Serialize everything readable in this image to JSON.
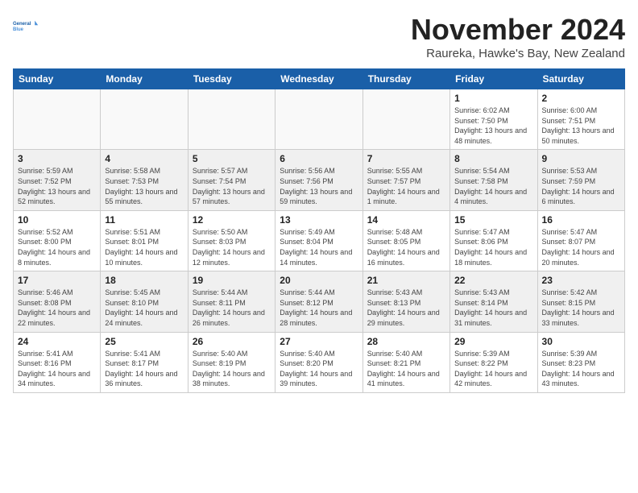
{
  "logo": {
    "line1": "General",
    "line2": "Blue"
  },
  "title": "November 2024",
  "location": "Raureka, Hawke's Bay, New Zealand",
  "days_of_week": [
    "Sunday",
    "Monday",
    "Tuesday",
    "Wednesday",
    "Thursday",
    "Friday",
    "Saturday"
  ],
  "weeks": [
    {
      "days": [
        {
          "num": "",
          "info": ""
        },
        {
          "num": "",
          "info": ""
        },
        {
          "num": "",
          "info": ""
        },
        {
          "num": "",
          "info": ""
        },
        {
          "num": "",
          "info": ""
        },
        {
          "num": "1",
          "info": "Sunrise: 6:02 AM\nSunset: 7:50 PM\nDaylight: 13 hours and 48 minutes."
        },
        {
          "num": "2",
          "info": "Sunrise: 6:00 AM\nSunset: 7:51 PM\nDaylight: 13 hours and 50 minutes."
        }
      ]
    },
    {
      "days": [
        {
          "num": "3",
          "info": "Sunrise: 5:59 AM\nSunset: 7:52 PM\nDaylight: 13 hours and 52 minutes."
        },
        {
          "num": "4",
          "info": "Sunrise: 5:58 AM\nSunset: 7:53 PM\nDaylight: 13 hours and 55 minutes."
        },
        {
          "num": "5",
          "info": "Sunrise: 5:57 AM\nSunset: 7:54 PM\nDaylight: 13 hours and 57 minutes."
        },
        {
          "num": "6",
          "info": "Sunrise: 5:56 AM\nSunset: 7:56 PM\nDaylight: 13 hours and 59 minutes."
        },
        {
          "num": "7",
          "info": "Sunrise: 5:55 AM\nSunset: 7:57 PM\nDaylight: 14 hours and 1 minute."
        },
        {
          "num": "8",
          "info": "Sunrise: 5:54 AM\nSunset: 7:58 PM\nDaylight: 14 hours and 4 minutes."
        },
        {
          "num": "9",
          "info": "Sunrise: 5:53 AM\nSunset: 7:59 PM\nDaylight: 14 hours and 6 minutes."
        }
      ]
    },
    {
      "days": [
        {
          "num": "10",
          "info": "Sunrise: 5:52 AM\nSunset: 8:00 PM\nDaylight: 14 hours and 8 minutes."
        },
        {
          "num": "11",
          "info": "Sunrise: 5:51 AM\nSunset: 8:01 PM\nDaylight: 14 hours and 10 minutes."
        },
        {
          "num": "12",
          "info": "Sunrise: 5:50 AM\nSunset: 8:03 PM\nDaylight: 14 hours and 12 minutes."
        },
        {
          "num": "13",
          "info": "Sunrise: 5:49 AM\nSunset: 8:04 PM\nDaylight: 14 hours and 14 minutes."
        },
        {
          "num": "14",
          "info": "Sunrise: 5:48 AM\nSunset: 8:05 PM\nDaylight: 14 hours and 16 minutes."
        },
        {
          "num": "15",
          "info": "Sunrise: 5:47 AM\nSunset: 8:06 PM\nDaylight: 14 hours and 18 minutes."
        },
        {
          "num": "16",
          "info": "Sunrise: 5:47 AM\nSunset: 8:07 PM\nDaylight: 14 hours and 20 minutes."
        }
      ]
    },
    {
      "days": [
        {
          "num": "17",
          "info": "Sunrise: 5:46 AM\nSunset: 8:08 PM\nDaylight: 14 hours and 22 minutes."
        },
        {
          "num": "18",
          "info": "Sunrise: 5:45 AM\nSunset: 8:10 PM\nDaylight: 14 hours and 24 minutes."
        },
        {
          "num": "19",
          "info": "Sunrise: 5:44 AM\nSunset: 8:11 PM\nDaylight: 14 hours and 26 minutes."
        },
        {
          "num": "20",
          "info": "Sunrise: 5:44 AM\nSunset: 8:12 PM\nDaylight: 14 hours and 28 minutes."
        },
        {
          "num": "21",
          "info": "Sunrise: 5:43 AM\nSunset: 8:13 PM\nDaylight: 14 hours and 29 minutes."
        },
        {
          "num": "22",
          "info": "Sunrise: 5:43 AM\nSunset: 8:14 PM\nDaylight: 14 hours and 31 minutes."
        },
        {
          "num": "23",
          "info": "Sunrise: 5:42 AM\nSunset: 8:15 PM\nDaylight: 14 hours and 33 minutes."
        }
      ]
    },
    {
      "days": [
        {
          "num": "24",
          "info": "Sunrise: 5:41 AM\nSunset: 8:16 PM\nDaylight: 14 hours and 34 minutes."
        },
        {
          "num": "25",
          "info": "Sunrise: 5:41 AM\nSunset: 8:17 PM\nDaylight: 14 hours and 36 minutes."
        },
        {
          "num": "26",
          "info": "Sunrise: 5:40 AM\nSunset: 8:19 PM\nDaylight: 14 hours and 38 minutes."
        },
        {
          "num": "27",
          "info": "Sunrise: 5:40 AM\nSunset: 8:20 PM\nDaylight: 14 hours and 39 minutes."
        },
        {
          "num": "28",
          "info": "Sunrise: 5:40 AM\nSunset: 8:21 PM\nDaylight: 14 hours and 41 minutes."
        },
        {
          "num": "29",
          "info": "Sunrise: 5:39 AM\nSunset: 8:22 PM\nDaylight: 14 hours and 42 minutes."
        },
        {
          "num": "30",
          "info": "Sunrise: 5:39 AM\nSunset: 8:23 PM\nDaylight: 14 hours and 43 minutes."
        }
      ]
    }
  ]
}
